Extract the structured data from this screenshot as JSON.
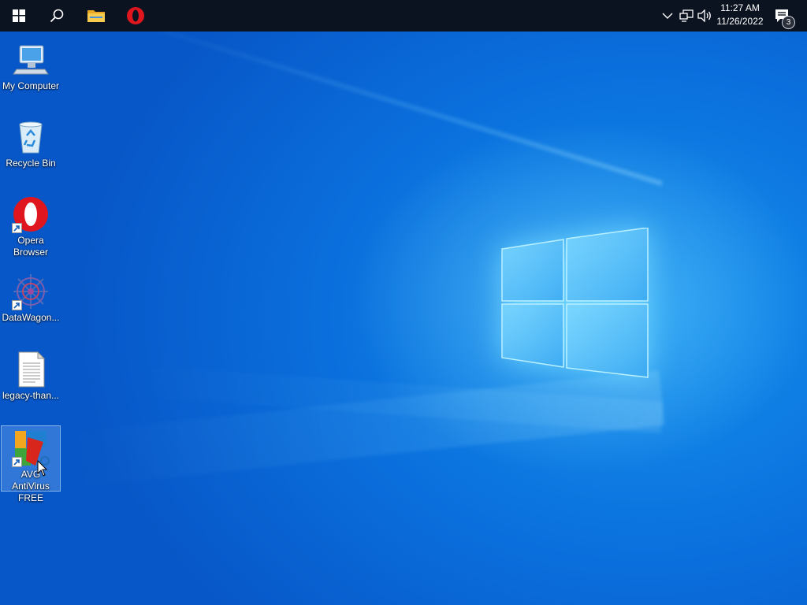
{
  "taskbar": {
    "start_icon": "windows-logo-icon",
    "search_icon": "search-icon",
    "pinned": [
      {
        "name": "File Explorer",
        "icon": "folder-icon"
      },
      {
        "name": "Opera",
        "icon": "opera-icon"
      }
    ],
    "tray": {
      "chevron_icon": "chevron-up-icon",
      "network_icon": "network-icon",
      "volume_icon": "volume-icon"
    },
    "clock": {
      "time": "11:27 AM",
      "date": "11/26/2022"
    },
    "notifications": {
      "icon": "action-center-icon",
      "count": "3"
    }
  },
  "desktop": {
    "wallpaper": "Windows 10 hero",
    "icons": [
      {
        "label": "My Computer",
        "icon": "computer-icon"
      },
      {
        "label": "Recycle Bin",
        "icon": "recycle-bin-icon"
      },
      {
        "label": "Opera Browser",
        "icon": "opera-icon",
        "shortcut": true
      },
      {
        "label": "DataWagon...",
        "icon": "datawagon-icon",
        "shortcut": true
      },
      {
        "label": "legacy-than...",
        "icon": "text-file-icon"
      },
      {
        "label": "AVG AntiVirus FREE",
        "icon": "avg-icon",
        "shortcut": true,
        "selected": true
      }
    ]
  },
  "colors": {
    "taskbar": "#0b1220",
    "desktop_blue": "#0a6fdc",
    "selection": "#99ccff"
  }
}
